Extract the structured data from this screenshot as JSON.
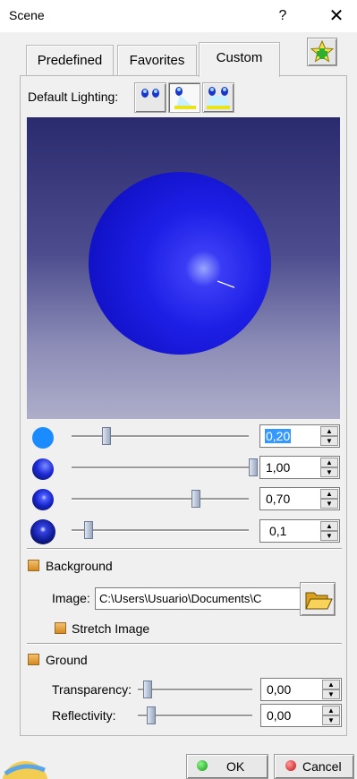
{
  "window": {
    "title": "Scene",
    "help": "?",
    "close": "✕"
  },
  "tabs": [
    {
      "label": "Predefined",
      "active": false
    },
    {
      "label": "Favorites",
      "active": false
    },
    {
      "label": "Custom",
      "active": true
    }
  ],
  "lighting": {
    "label": "Default Lighting:",
    "buttons": [
      {
        "icon": "two-lights-icon",
        "pressed": false
      },
      {
        "icon": "single-spotlight-icon",
        "pressed": true
      },
      {
        "icon": "two-spotlights-icon",
        "pressed": false
      }
    ]
  },
  "material_rows": [
    {
      "icon": "ambient-sphere-icon",
      "value": "0,20",
      "slider": 0.2,
      "selected": true
    },
    {
      "icon": "diffuse-sphere-icon",
      "value": "1,00",
      "slider": 1.0,
      "selected": false
    },
    {
      "icon": "specular-sphere-icon",
      "value": "0,70",
      "slider": 0.7,
      "selected": false
    },
    {
      "icon": "shininess-sphere-icon",
      "value": "0,1",
      "slider": 0.02,
      "selected": false
    }
  ],
  "background": {
    "label": "Background",
    "image_label": "Image:",
    "image_path": "C:\\Users\\Usuario\\Documents\\C",
    "stretch_label": "Stretch Image"
  },
  "ground": {
    "label": "Ground",
    "transparency_label": "Transparency:",
    "transparency_value": "0,00",
    "reflectivity_label": "Reflectivity:",
    "reflectivity_value": "0,00"
  },
  "buttons": {
    "ok": "OK",
    "cancel": "Cancel"
  },
  "colors": {
    "accent_selection": "#3399ff",
    "sphere": "#1a1ae0",
    "check": "#e0952e"
  }
}
